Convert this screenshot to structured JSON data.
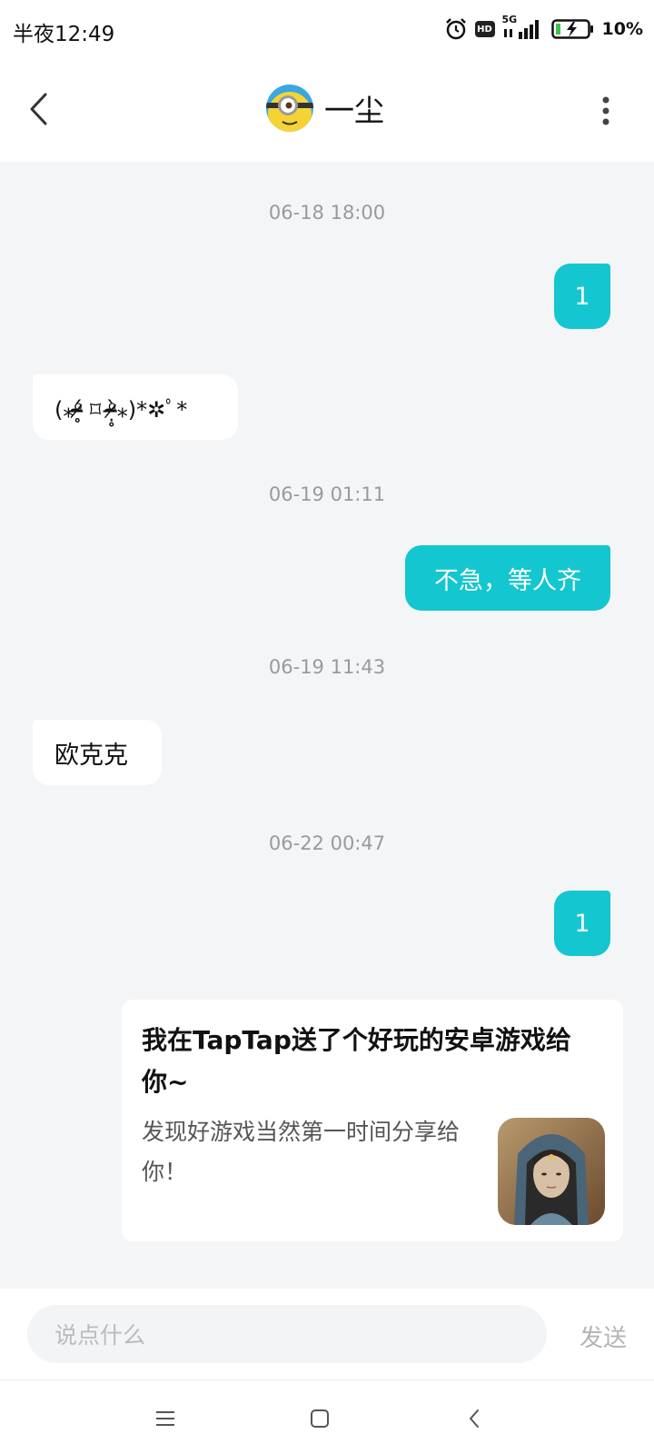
{
  "status_bar": {
    "time": "半夜12:49",
    "network": "5G",
    "hd": "HD",
    "battery": "10%"
  },
  "header": {
    "title": "一尘",
    "avatar_icon": "minion-avatar",
    "back_icon": "chevron-left-icon",
    "more_icon": "more-vertical-icon"
  },
  "messages": [
    {
      "type": "timestamp",
      "text": "06-18 18:00"
    },
    {
      "type": "sent",
      "text": "1"
    },
    {
      "type": "received",
      "text": "(⁎ᵒ̴̶̷̥́ ⌑ ᵒ̴̶̷̣̥̀⁎)*✲ﾟ*"
    },
    {
      "type": "timestamp",
      "text": "06-19 01:11"
    },
    {
      "type": "sent",
      "text": "不急，等人齐"
    },
    {
      "type": "timestamp",
      "text": "06-19 11:43"
    },
    {
      "type": "received",
      "text": "欧克克"
    },
    {
      "type": "timestamp",
      "text": "06-22 00:47"
    },
    {
      "type": "sent",
      "text": "1"
    }
  ],
  "share_card": {
    "title": "我在TapTap送了个好玩的安卓游戏给你~",
    "description": "发现好游戏当然第一时间分享给你！",
    "thumbnail_icon": "game-cover-image"
  },
  "input_bar": {
    "placeholder": "说点什么",
    "send_label": "发送"
  },
  "nav_bar": {
    "items": [
      "menu-icon",
      "home-icon",
      "back-icon"
    ]
  },
  "colors": {
    "accent": "#14c6cf",
    "background": "#f4f5f7"
  }
}
